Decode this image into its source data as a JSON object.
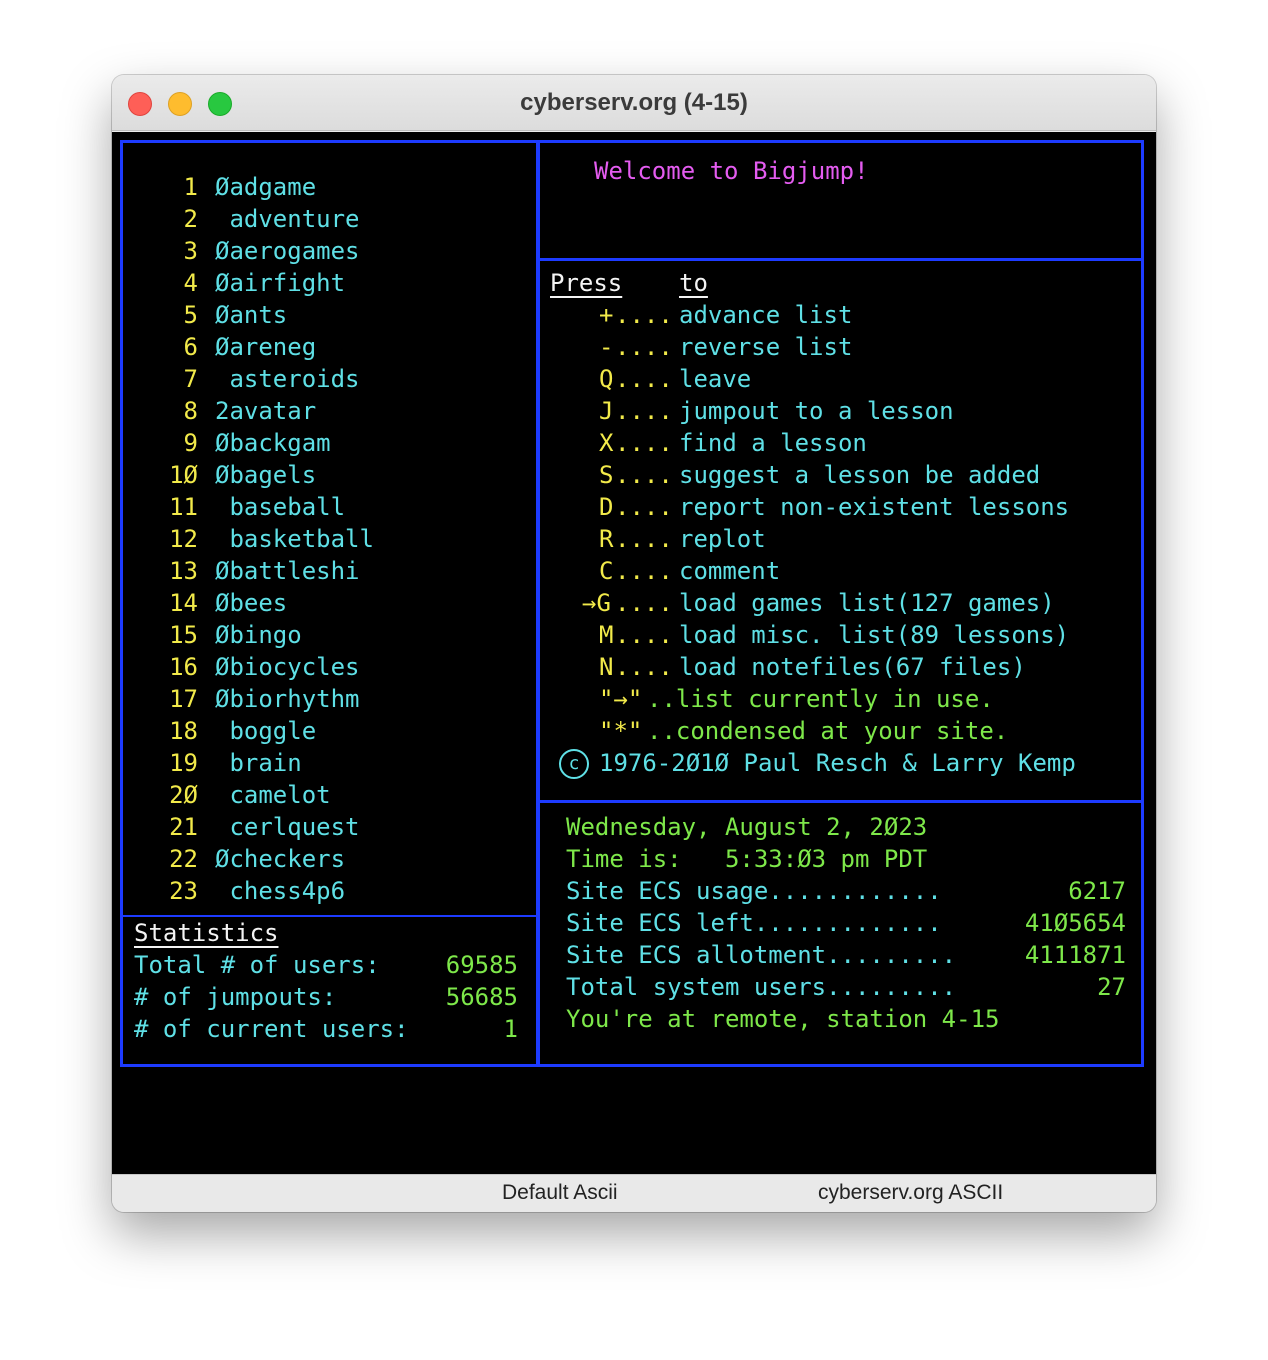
{
  "window": {
    "title": "cyberserv.org (4-15)"
  },
  "statusbar": {
    "left": "Default Ascii",
    "right": "cyberserv.org ASCII"
  },
  "games": [
    {
      "num": "1",
      "name": "Øadgame"
    },
    {
      "num": "2",
      "name": " adventure"
    },
    {
      "num": "3",
      "name": "Øaerogames"
    },
    {
      "num": "4",
      "name": "Øairfight"
    },
    {
      "num": "5",
      "name": "Øants"
    },
    {
      "num": "6",
      "name": "Øareneg"
    },
    {
      "num": "7",
      "name": " asteroids"
    },
    {
      "num": "8",
      "name": "2avatar"
    },
    {
      "num": "9",
      "name": "Øbackgam"
    },
    {
      "num": "1Ø",
      "name": "Øbagels"
    },
    {
      "num": "11",
      "name": " baseball"
    },
    {
      "num": "12",
      "name": " basketball"
    },
    {
      "num": "13",
      "name": "Øbattleshi"
    },
    {
      "num": "14",
      "name": "Øbees"
    },
    {
      "num": "15",
      "name": "Øbingo"
    },
    {
      "num": "16",
      "name": "Øbiocycles"
    },
    {
      "num": "17",
      "name": "Øbiorhythm"
    },
    {
      "num": "18",
      "name": " boggle"
    },
    {
      "num": "19",
      "name": " brain"
    },
    {
      "num": "2Ø",
      "name": " camelot"
    },
    {
      "num": "21",
      "name": " cerlquest"
    },
    {
      "num": "22",
      "name": "Øcheckers"
    },
    {
      "num": "23",
      "name": " chess4p6"
    }
  ],
  "stats": {
    "heading": "Statistics",
    "rows": [
      {
        "label": "Total # of users:",
        "value": "69585"
      },
      {
        "label": "# of jumpouts:",
        "value": "56685"
      },
      {
        "label": "# of current users:",
        "value": "1"
      }
    ]
  },
  "welcome": "Welcome to Bigjump!",
  "menu": {
    "press_header": "Press",
    "to_header": "to",
    "items": [
      {
        "key": "+",
        "dots": "....",
        "desc": "advance list"
      },
      {
        "key": "-",
        "dots": "....",
        "desc": "reverse list"
      },
      {
        "key": "Q",
        "dots": "....",
        "desc": "leave"
      },
      {
        "key": "J",
        "dots": "....",
        "desc": "jumpout to a lesson"
      },
      {
        "key": "X",
        "dots": "....",
        "desc": "find a lesson"
      },
      {
        "key": "S",
        "dots": "....",
        "desc": "suggest a lesson be added"
      },
      {
        "key": "D",
        "dots": "....",
        "desc": "report non-existent lessons"
      },
      {
        "key": "R",
        "dots": "....",
        "desc": "replot"
      },
      {
        "key": "C",
        "dots": "....",
        "desc": "comment"
      },
      {
        "key": "→G",
        "dots": "....",
        "desc": "load games list(127 games)"
      },
      {
        "key": "M",
        "dots": "....",
        "desc": "load misc. list(89 lessons)"
      },
      {
        "key": "N",
        "dots": "....",
        "desc": "load notefiles(67 files)"
      }
    ],
    "legend1_sym": "\"→\"",
    "legend1_text": "..list currently in use.",
    "legend2_sym": "\"*\"",
    "legend2_text": "..condensed at your site.",
    "copyright": "1976-2Ø1Ø Paul Resch & Larry Kemp"
  },
  "info": {
    "date": "Wednesday, August 2, 2Ø23",
    "time": "Time is:   5:33:Ø3 pm PDT",
    "rows": [
      {
        "label": "Site ECS usage............",
        "value": "6217"
      },
      {
        "label": "Site ECS left.............",
        "value": "41Ø5654"
      },
      {
        "label": "Site ECS allotment.........",
        "value": "4111871"
      },
      {
        "label": "Total system users.........",
        "value": "27"
      }
    ],
    "station": "You're at remote, station 4-15"
  }
}
